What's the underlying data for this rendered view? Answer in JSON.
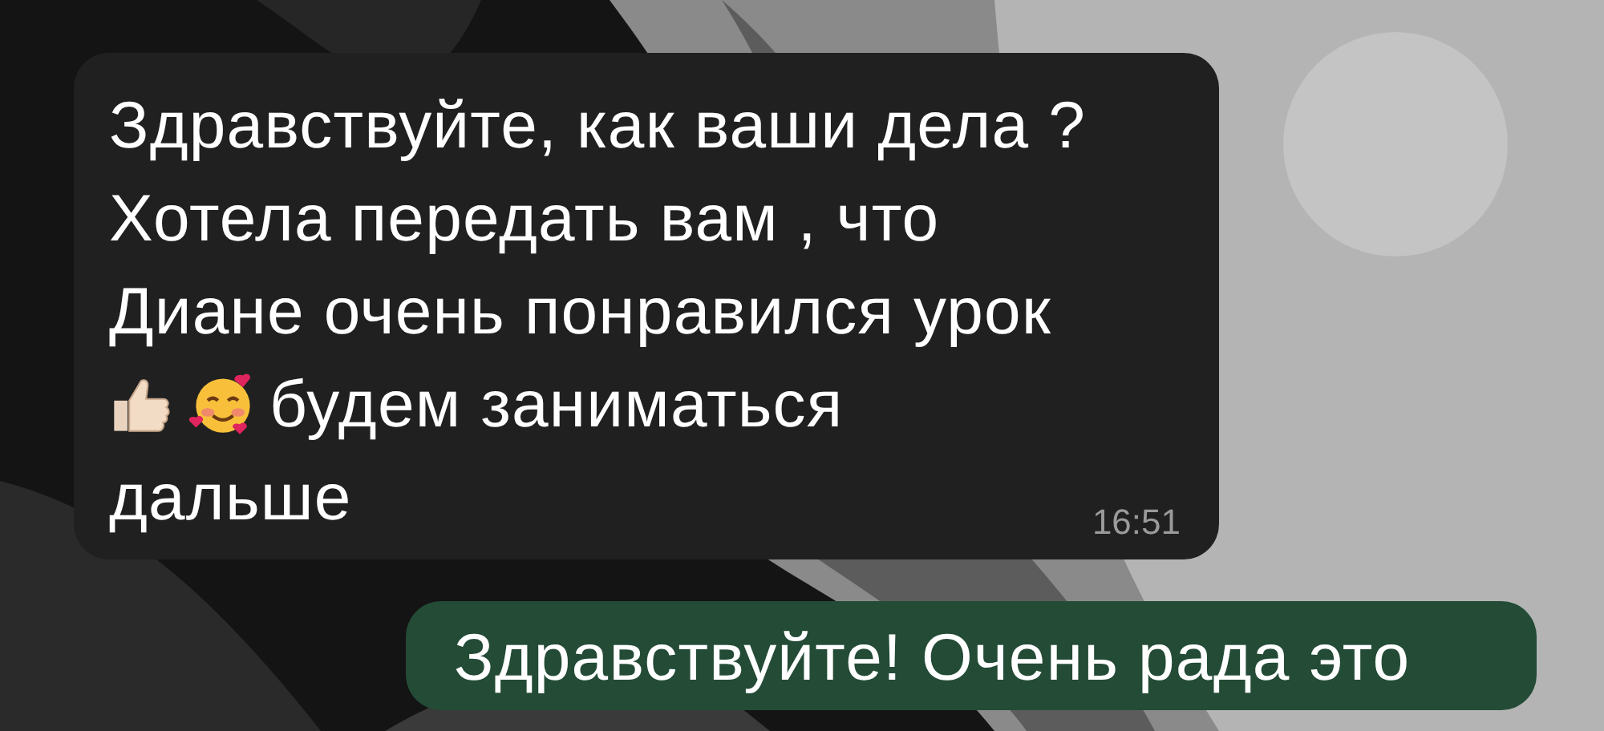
{
  "messages": [
    {
      "kind": "incoming",
      "lines": [
        [
          {
            "kind": "text",
            "text": "Здравствуйте, как ваши дела ?"
          }
        ],
        [
          {
            "kind": "text",
            "text": "Хотела передать вам , что"
          }
        ],
        [
          {
            "kind": "text",
            "text": "Диане очень понравился урок"
          }
        ],
        [
          {
            "kind": "thumb"
          },
          {
            "kind": "hearts"
          },
          {
            "kind": "text",
            "text": "будем заниматься"
          }
        ],
        [
          {
            "kind": "text",
            "text": "дальше"
          }
        ]
      ],
      "time": "16:51"
    },
    {
      "kind": "outgoing",
      "lines": [
        [
          {
            "kind": "text",
            "text": "Здравствуйте! Очень рада это"
          }
        ]
      ]
    }
  ]
}
